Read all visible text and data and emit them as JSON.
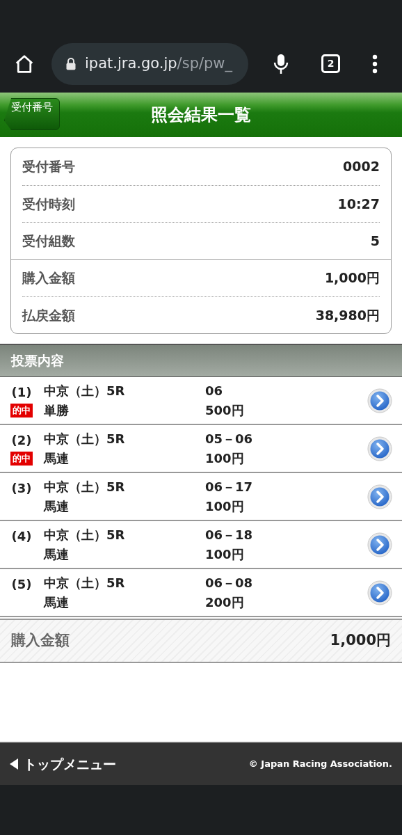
{
  "browser": {
    "url_host": "ipat.jra.go.jp",
    "url_path": "/sp/pw_",
    "tab_count": "2"
  },
  "header": {
    "back_button": "受付番号",
    "title": "照会結果一覧"
  },
  "summary_groups": [
    [
      {
        "label": "受付番号",
        "value": "0002"
      },
      {
        "label": "受付時刻",
        "value": "10:27"
      },
      {
        "label": "受付組数",
        "value": "5"
      }
    ],
    [
      {
        "label": "購入金額",
        "value": "1,000円"
      },
      {
        "label": "払戻金額",
        "value": "38,980円"
      }
    ]
  ],
  "section_title": "投票内容",
  "bets": [
    {
      "number": "(1)",
      "race": "中京（土）5R",
      "bet_type": "単勝",
      "combination": "06",
      "amount": "500円",
      "hit": true,
      "hit_label": "的中"
    },
    {
      "number": "(2)",
      "race": "中京（土）5R",
      "bet_type": "馬連",
      "combination": "05－06",
      "amount": "100円",
      "hit": true,
      "hit_label": "的中"
    },
    {
      "number": "(3)",
      "race": "中京（土）5R",
      "bet_type": "馬連",
      "combination": "06－17",
      "amount": "100円",
      "hit": false
    },
    {
      "number": "(4)",
      "race": "中京（土）5R",
      "bet_type": "馬連",
      "combination": "06－18",
      "amount": "100円",
      "hit": false
    },
    {
      "number": "(5)",
      "race": "中京（土）5R",
      "bet_type": "馬連",
      "combination": "06－08",
      "amount": "200円",
      "hit": false
    }
  ],
  "total": {
    "label": "購入金額",
    "value": "1,000円"
  },
  "footer": {
    "menu_link": "トップメニュー",
    "copyright": "© Japan Racing Association."
  }
}
